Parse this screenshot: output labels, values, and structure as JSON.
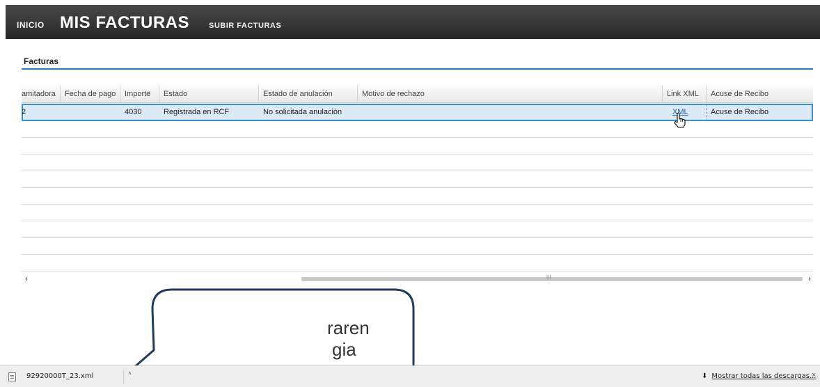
{
  "nav": {
    "inicio": "INICIO",
    "mis_facturas": "MIS FACTURAS",
    "subir_facturas": "SUBIR FACTURAS"
  },
  "section": {
    "title": "Facturas"
  },
  "table": {
    "columns": [
      "amitadora",
      "Fecha de pago",
      "Importe",
      "Estado",
      "Estado de anulación",
      "Motivo de rechazo",
      "Link XML",
      "Acuse de Recibo"
    ],
    "rows": [
      [
        "2",
        "",
        "4030",
        "Registrada en RCF",
        "No solicitada anulación",
        "",
        "XML",
        "Acuse de Recibo"
      ]
    ]
  },
  "scrollbar": {
    "left_arrow": "‹",
    "right_arrow": "›",
    "grip": "III"
  },
  "download_bar": {
    "file_name": "92920000T_23.xml",
    "caret": "˄",
    "show_all": "Mostrar todas las descargas...",
    "download_arrow": "⬇",
    "close": "×"
  },
  "bubble": {
    "line1": "raren",
    "line2": "gia"
  },
  "icons": {
    "file": "file-icon",
    "cursor": "hand-pointer-icon"
  },
  "colors": {
    "nav_bg": "#333333",
    "accent": "#2a76b8",
    "selection": "#dce9f7",
    "link": "#1f5fa8"
  }
}
